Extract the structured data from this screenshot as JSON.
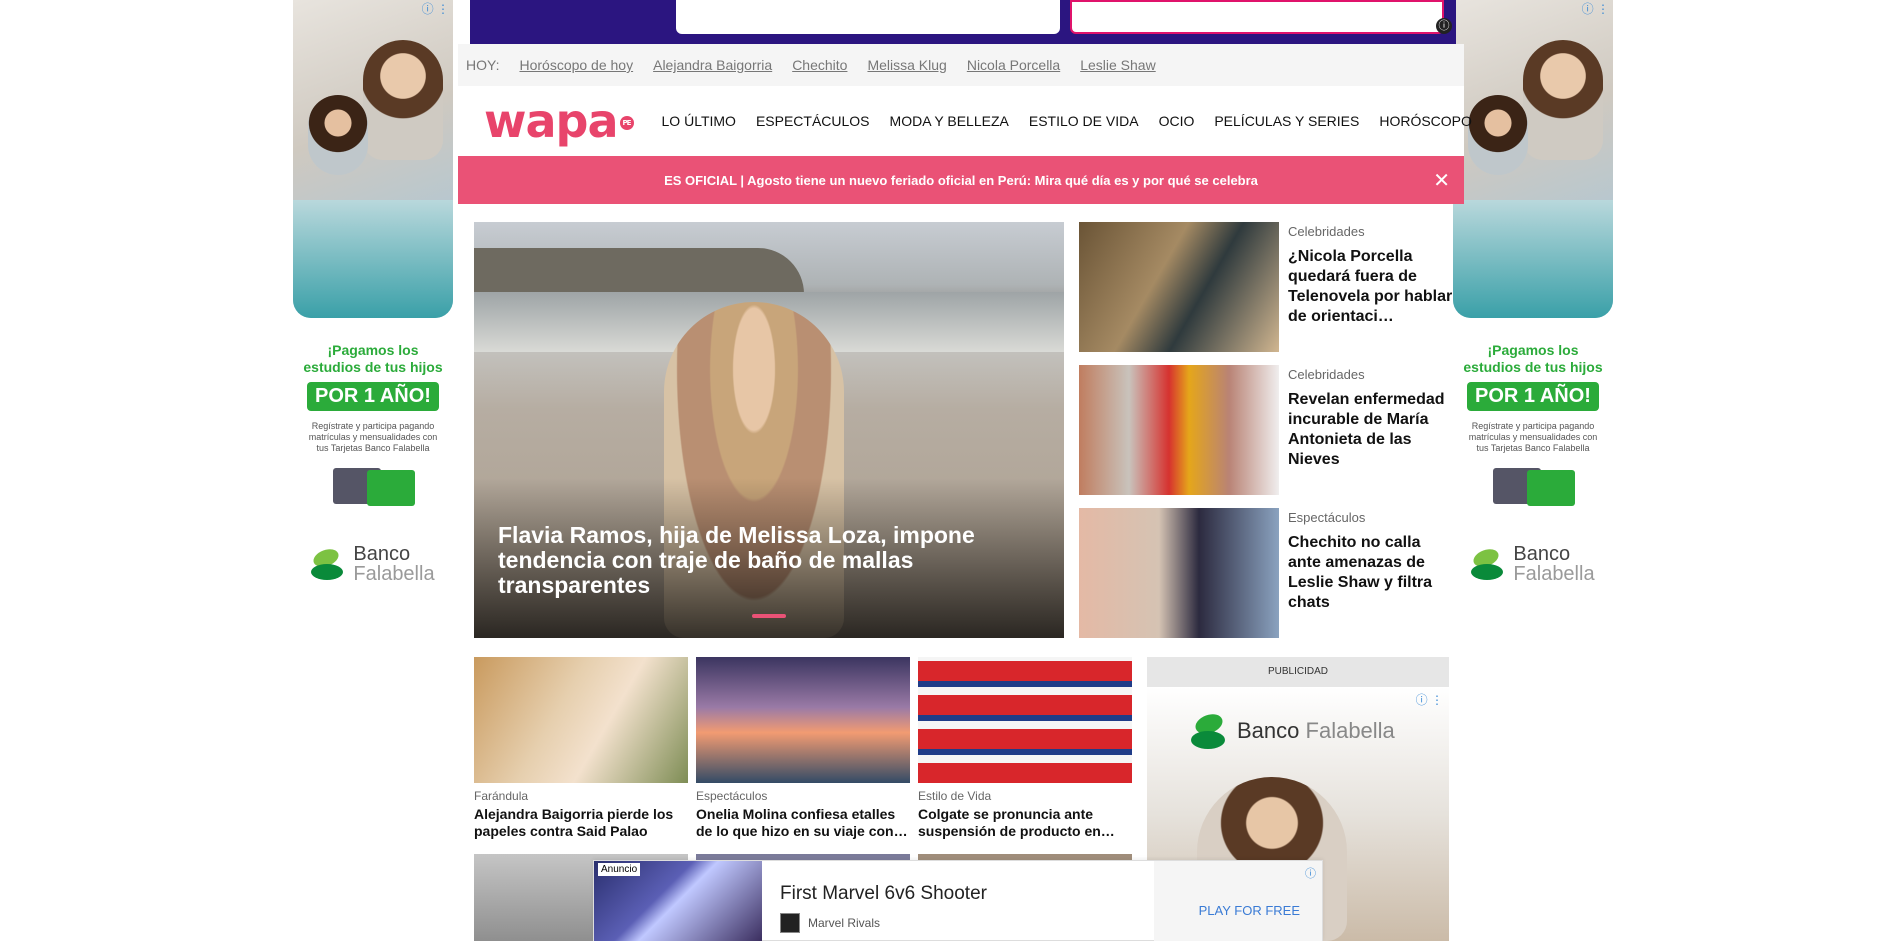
{
  "side_ad": {
    "line1": "¡Pagamos los",
    "line2": "estudios de tus hijos",
    "badge": "POR 1 AÑO!",
    "small": "Regístrate y participa pagando matrículas y mensualidades con tus Tarjetas Banco Falabella",
    "bank_a": "Banco",
    "bank_b": "Falabella",
    "icons": "ⓘ ⋮"
  },
  "trending": {
    "label": "HOY:",
    "links": [
      "Horóscopo de hoy",
      "Alejandra Baigorria",
      "Chechito",
      "Melissa Klug",
      "Nicola Porcella",
      "Leslie Shaw"
    ]
  },
  "header": {
    "logo": "wapa",
    "logo_badge": "PE",
    "nav": [
      "LO ÚLTIMO",
      "ESPECTÁCULOS",
      "MODA Y BELLEZA",
      "ESTILO DE VIDA",
      "OCIO",
      "PELÍCULAS Y SERIES",
      "HORÓSCOPO"
    ]
  },
  "breaking": {
    "text": "ES OFICIAL | Agosto tiene un nuevo feriado oficial en Perú: Mira qué día es y por qué se celebra",
    "close": "✕"
  },
  "hero": {
    "title": "Flavia Ramos, hija de Melissa Loza, impone tendencia con traje de baño de mallas transparentes"
  },
  "side_list": [
    {
      "category": "Celebridades",
      "title": "¿Nicola Porcella quedará fuera de Telenovela por hablar de orientaci…"
    },
    {
      "category": "Celebridades",
      "title": "Revelan enfermedad incurable de María Antonieta de las Nieves"
    },
    {
      "category": "Espectáculos",
      "title": "Chechito no calla ante amenazas de Leslie Shaw y filtra chats"
    }
  ],
  "grid": [
    {
      "category": "Farándula",
      "title": "Alejandra Baigorria pierde los papeles contra Said Palao"
    },
    {
      "category": "Espectáculos",
      "title": "Onelia Molina confiesa etalles de lo que hizo en su viaje con…"
    },
    {
      "category": "Estilo de Vida",
      "title": "Colgate se pronuncia ante suspensión de producto en…"
    }
  ],
  "publicidad": {
    "header": "PUBLICIDAD",
    "bank_a": "Banco",
    "bank_b": "Falabella",
    "icons": "ⓘ ⋮"
  },
  "bottom_ad": {
    "tag": "Anuncio",
    "headline": "First Marvel 6v6 Shooter",
    "brand": "Marvel Rivals",
    "cta": "PLAY FOR FREE",
    "info": "ⓘ"
  },
  "top_ad": {
    "info": "ⓘ"
  },
  "colors": {
    "brand_pink": "#e8446b",
    "breaking_bg": "#ea5276",
    "falabella_green": "#2bab3a"
  }
}
